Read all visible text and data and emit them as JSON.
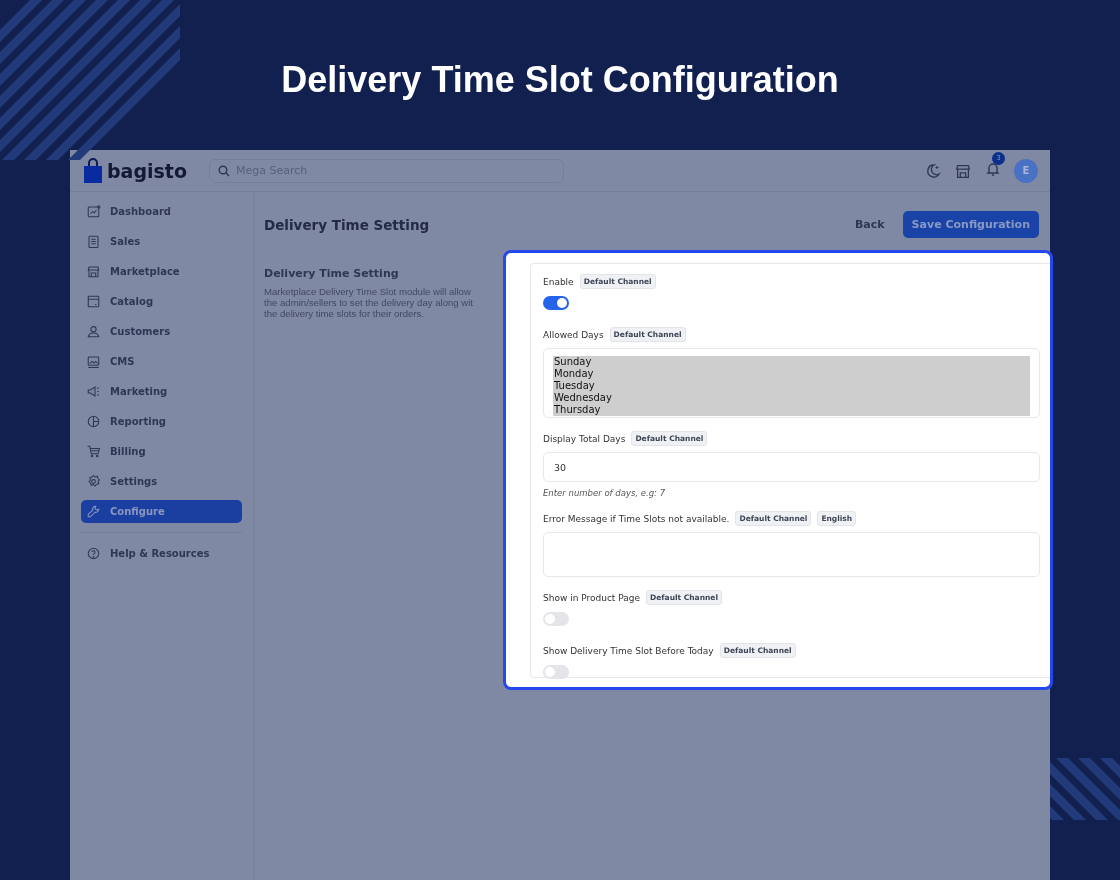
{
  "banner": {
    "title": "Delivery Time Slot Configuration"
  },
  "header": {
    "logo": "bagisto",
    "search": {
      "placeholder": "Mega Search"
    },
    "notification_count": "3",
    "avatar": "E"
  },
  "sidebar": {
    "items": [
      {
        "label": "Dashboard",
        "selected": false
      },
      {
        "label": "Sales",
        "selected": false
      },
      {
        "label": "Marketplace",
        "selected": false
      },
      {
        "label": "Catalog",
        "selected": false
      },
      {
        "label": "Customers",
        "selected": false
      },
      {
        "label": "CMS",
        "selected": false
      },
      {
        "label": "Marketing",
        "selected": false
      },
      {
        "label": "Reporting",
        "selected": false
      },
      {
        "label": "Billing",
        "selected": false
      },
      {
        "label": "Settings",
        "selected": false
      },
      {
        "label": "Configure",
        "selected": true
      }
    ],
    "footer": {
      "label": "Help & Resources"
    }
  },
  "page": {
    "title": "Delivery Time Setting",
    "actions": [
      {
        "label": "Back",
        "kind": "link"
      },
      {
        "label": "Save Configuration",
        "kind": "primary"
      }
    ],
    "section": {
      "title": "Delivery Time Setting",
      "description_lines": [
        "Marketplace Delivery Time Slot module will allow",
        "the admin/sellers to set the delivery day along wit",
        "the delivery time slots for their orders."
      ]
    }
  },
  "settings_panel": {
    "fields": [
      {
        "kind": "toggle",
        "label": "Enable",
        "badges": [
          "Default Channel"
        ],
        "on": true
      },
      {
        "kind": "multiselect",
        "label": "Allowed Days",
        "badges": [
          "Default Channel"
        ],
        "options": [
          {
            "label": "Sunday",
            "selected": true
          },
          {
            "label": "Monday",
            "selected": true
          },
          {
            "label": "Tuesday",
            "selected": true
          },
          {
            "label": "Wednesday",
            "selected": true
          },
          {
            "label": "Thursday",
            "selected": true
          }
        ]
      },
      {
        "kind": "number",
        "label": "Display Total Days",
        "badges": [
          "Default Channel"
        ],
        "value": "30",
        "hint": "Enter number of days, e.g: 7"
      },
      {
        "kind": "textarea",
        "label": "Error Message if Time Slots not available.",
        "badges": [
          "Default Channel",
          "English"
        ]
      },
      {
        "kind": "toggle",
        "label": "Show in Product Page",
        "badges": [
          "Default Channel"
        ],
        "on": false
      },
      {
        "kind": "toggle",
        "label": "Show Delivery Time Slot Before Today",
        "badges": [
          "Default Channel"
        ],
        "on": false
      }
    ]
  }
}
